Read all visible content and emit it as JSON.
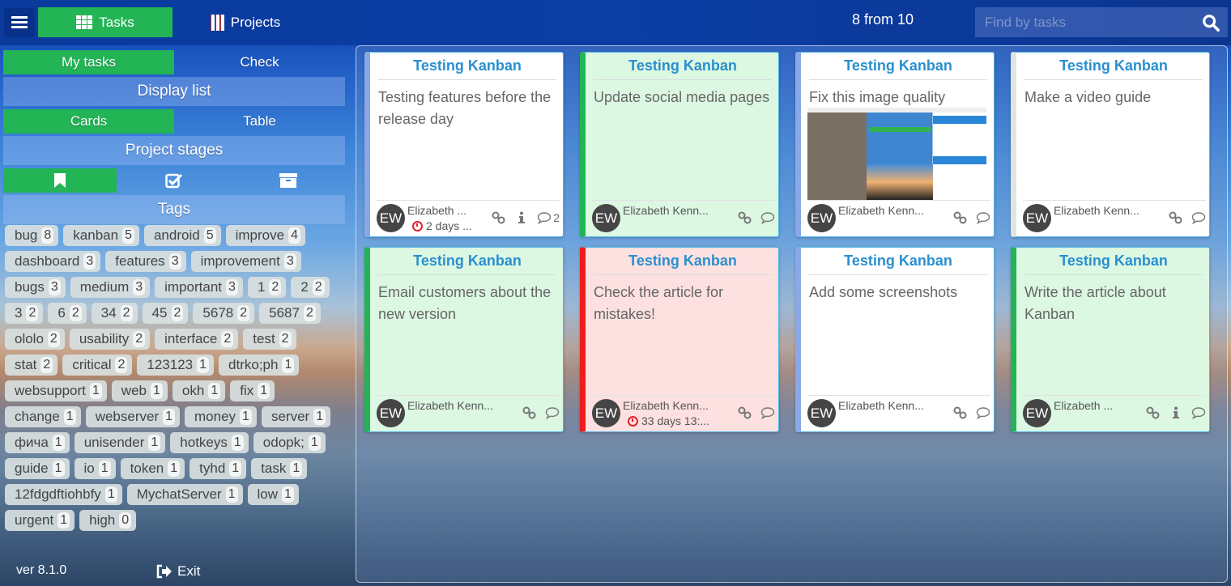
{
  "topbar": {
    "tabs": [
      {
        "label": "Tasks",
        "icon": "grid-icon",
        "active": true
      },
      {
        "label": "Projects",
        "icon": "projects-icon",
        "active": false
      }
    ],
    "counter": "8 from 10",
    "search": {
      "placeholder": "Find by tasks",
      "value": ""
    }
  },
  "sidebar": {
    "filter": [
      {
        "label": "My tasks",
        "active": true
      },
      {
        "label": "Check",
        "active": false
      }
    ],
    "display_title": "Display list",
    "display": [
      {
        "label": "Cards",
        "active": true
      },
      {
        "label": "Table",
        "active": false
      }
    ],
    "stages_title": "Project stages",
    "stages": [
      {
        "icon": "bookmark-icon",
        "active": true
      },
      {
        "icon": "check-square-icon",
        "active": false
      },
      {
        "icon": "archive-icon",
        "active": false
      }
    ],
    "tags_title": "Tags",
    "tags": [
      {
        "name": "bug",
        "count": "8"
      },
      {
        "name": "kanban",
        "count": "5"
      },
      {
        "name": "android",
        "count": "5"
      },
      {
        "name": "improve",
        "count": "4"
      },
      {
        "name": "dashboard",
        "count": "3"
      },
      {
        "name": "features",
        "count": "3"
      },
      {
        "name": "improvement",
        "count": "3"
      },
      {
        "name": "bugs",
        "count": "3"
      },
      {
        "name": "medium",
        "count": "3"
      },
      {
        "name": "important",
        "count": "3"
      },
      {
        "name": "1",
        "count": "2"
      },
      {
        "name": "2",
        "count": "2"
      },
      {
        "name": "3",
        "count": "2"
      },
      {
        "name": "6",
        "count": "2"
      },
      {
        "name": "34",
        "count": "2"
      },
      {
        "name": "45",
        "count": "2"
      },
      {
        "name": "5678",
        "count": "2"
      },
      {
        "name": "5687",
        "count": "2"
      },
      {
        "name": "ololo",
        "count": "2"
      },
      {
        "name": "usability",
        "count": "2"
      },
      {
        "name": "interface",
        "count": "2"
      },
      {
        "name": "test",
        "count": "2"
      },
      {
        "name": "stat",
        "count": "2"
      },
      {
        "name": "critical",
        "count": "2"
      },
      {
        "name": "123123",
        "count": "1"
      },
      {
        "name": "dtrko;ph",
        "count": "1"
      },
      {
        "name": "websupport",
        "count": "1"
      },
      {
        "name": "web",
        "count": "1"
      },
      {
        "name": "okh",
        "count": "1"
      },
      {
        "name": "fix",
        "count": "1"
      },
      {
        "name": "change",
        "count": "1"
      },
      {
        "name": "webserver",
        "count": "1"
      },
      {
        "name": "money",
        "count": "1"
      },
      {
        "name": "server",
        "count": "1"
      },
      {
        "name": "фича",
        "count": "1"
      },
      {
        "name": "unisender",
        "count": "1"
      },
      {
        "name": "hotkeys",
        "count": "1"
      },
      {
        "name": "odopk;",
        "count": "1"
      },
      {
        "name": "guide",
        "count": "1"
      },
      {
        "name": "io",
        "count": "1"
      },
      {
        "name": "token",
        "count": "1"
      },
      {
        "name": "tyhd",
        "count": "1"
      },
      {
        "name": "task",
        "count": "1"
      },
      {
        "name": "12fdgdftiohbfy",
        "count": "1"
      },
      {
        "name": "MychatServer",
        "count": "1"
      },
      {
        "name": "low",
        "count": "1"
      },
      {
        "name": "urgent",
        "count": "1"
      },
      {
        "name": "high",
        "count": "0"
      }
    ],
    "version": "ver 8.1.0",
    "exit_label": "Exit"
  },
  "colors": {
    "accent_green": "#22b455",
    "project_title": "#2a8fd0",
    "overdue_red": "#e0242a",
    "card_green_bg": "#dcf7e2",
    "card_red_bg": "#fde0e0"
  },
  "cards": [
    {
      "project": "Testing Kanban",
      "text": "Testing features before the release day",
      "assignee": "Elizabeth ...",
      "initials": "EW",
      "due": "2 days ...",
      "status": "white",
      "stripe": "#8aa8e8",
      "has_info": true,
      "comments": "2",
      "has_image": false
    },
    {
      "project": "Testing Kanban",
      "text": "Update social media pages",
      "assignee": "Elizabeth Kenn...",
      "initials": "EW",
      "due": "",
      "status": "green",
      "stripe": "#22b455",
      "has_info": false,
      "comments": "",
      "has_image": false
    },
    {
      "project": "Testing Kanban",
      "text": "Fix this image quality",
      "assignee": "Elizabeth Kenn...",
      "initials": "EW",
      "due": "",
      "status": "white",
      "stripe": "#8aa8e8",
      "has_info": false,
      "comments": "",
      "has_image": true
    },
    {
      "project": "Testing Kanban",
      "text": "Make a video guide",
      "assignee": "Elizabeth Kenn...",
      "initials": "EW",
      "due": "",
      "status": "white",
      "stripe": "#e2e4e0",
      "has_info": false,
      "comments": "",
      "has_image": false
    },
    {
      "project": "Testing Kanban",
      "text": "Email customers about the new version",
      "assignee": "Elizabeth Kenn...",
      "initials": "EW",
      "due": "",
      "status": "green",
      "stripe": "#22b455",
      "has_info": false,
      "comments": "",
      "has_image": false
    },
    {
      "project": "Testing Kanban",
      "text": "Check the article for mistakes!",
      "assignee": "Elizabeth Kenn...",
      "initials": "EW",
      "due": "33 days 13:...",
      "status": "red",
      "stripe": "#ee1c1c",
      "has_info": false,
      "comments": "",
      "has_image": false
    },
    {
      "project": "Testing Kanban",
      "text": "Add some screenshots",
      "assignee": "Elizabeth Kenn...",
      "initials": "EW",
      "due": "",
      "status": "white",
      "stripe": "#8aa8e8",
      "has_info": false,
      "comments": "",
      "has_image": false
    },
    {
      "project": "Testing Kanban",
      "text": "Write the article about Kanban",
      "assignee": "Elizabeth ...",
      "initials": "EW",
      "due": "",
      "status": "green",
      "stripe": "#22b455",
      "has_info": true,
      "comments": "",
      "has_image": false
    }
  ]
}
